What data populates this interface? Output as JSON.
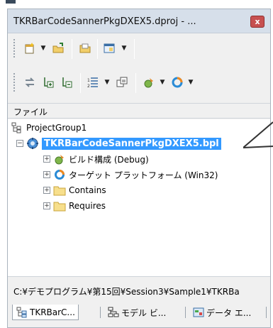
{
  "window": {
    "title": "TKRBarCodeSannerPkgDXEX5.dproj - ...",
    "close_label": "x"
  },
  "panel": {
    "header": "ファイル"
  },
  "tree": {
    "group": "ProjectGroup1",
    "project": "TKRBarCodeSannerPkgDXEX5.bpl",
    "children": [
      {
        "label": "ビルド構成 (Debug)",
        "icon": "build-config-icon"
      },
      {
        "label": "ターゲット プラットフォーム (Win32)",
        "icon": "target-platform-icon"
      },
      {
        "label": "Contains",
        "icon": "folder-icon"
      },
      {
        "label": "Requires",
        "icon": "folder-icon"
      }
    ]
  },
  "path": "C:¥デモプログラム¥第15回¥Session3¥Sample1¥TKRBa",
  "tabs": [
    {
      "label": "TKRBarC...",
      "icon": "project-manager-icon"
    },
    {
      "label": "モデル ビ...",
      "icon": "model-view-icon"
    },
    {
      "label": "データ エ...",
      "icon": "data-explorer-icon"
    }
  ],
  "colors": {
    "selection": "#3399ff",
    "titlebar": "#d6dfea",
    "close": "#c75050"
  }
}
